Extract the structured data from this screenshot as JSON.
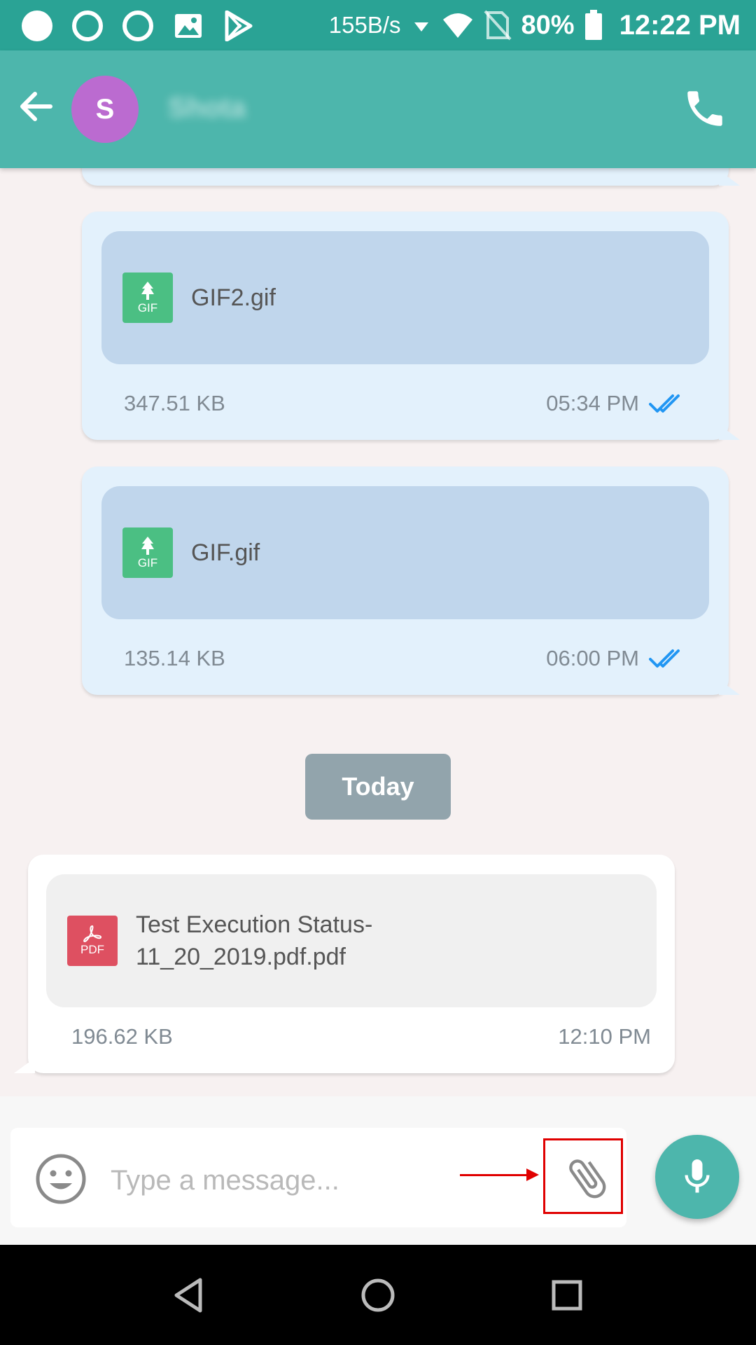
{
  "status_bar": {
    "speed": "155B/s",
    "battery_pct": "80%",
    "time": "12:22 PM",
    "icons": [
      "circle-filled-icon",
      "circle-outline-icon",
      "circle-outline-icon",
      "image-icon",
      "play-store-icon",
      "wifi-icon",
      "no-sim-icon",
      "battery-icon"
    ]
  },
  "header": {
    "avatar_letter": "S",
    "contact_name": "Shota",
    "avatar_color": "#bb6bd0",
    "accent": "#4db6ac"
  },
  "messages": [
    {
      "direction": "outgoing",
      "file_type": "GIF",
      "file_name": "GIF2.gif",
      "size": "347.51 KB",
      "time": "05:34 PM",
      "read": true
    },
    {
      "direction": "outgoing",
      "file_type": "GIF",
      "file_name": "GIF.gif",
      "size": "135.14 KB",
      "time": "06:00 PM",
      "read": true
    },
    {
      "direction": "incoming",
      "file_type": "PDF",
      "file_name_line1": "Test Execution Status-",
      "file_name_line2": "11_20_2019.pdf.pdf",
      "size": "196.62 KB",
      "time": "12:10 PM"
    }
  ],
  "date_divider": "Today",
  "composer": {
    "placeholder": "Type a message..."
  },
  "colors": {
    "status_bar": "#2aa395",
    "outgoing_bubble": "#e3f1fc",
    "gif_icon": "#4bbf83",
    "pdf_icon": "#de5061",
    "read_ticks": "#2196f3",
    "highlight": "#e00000"
  }
}
